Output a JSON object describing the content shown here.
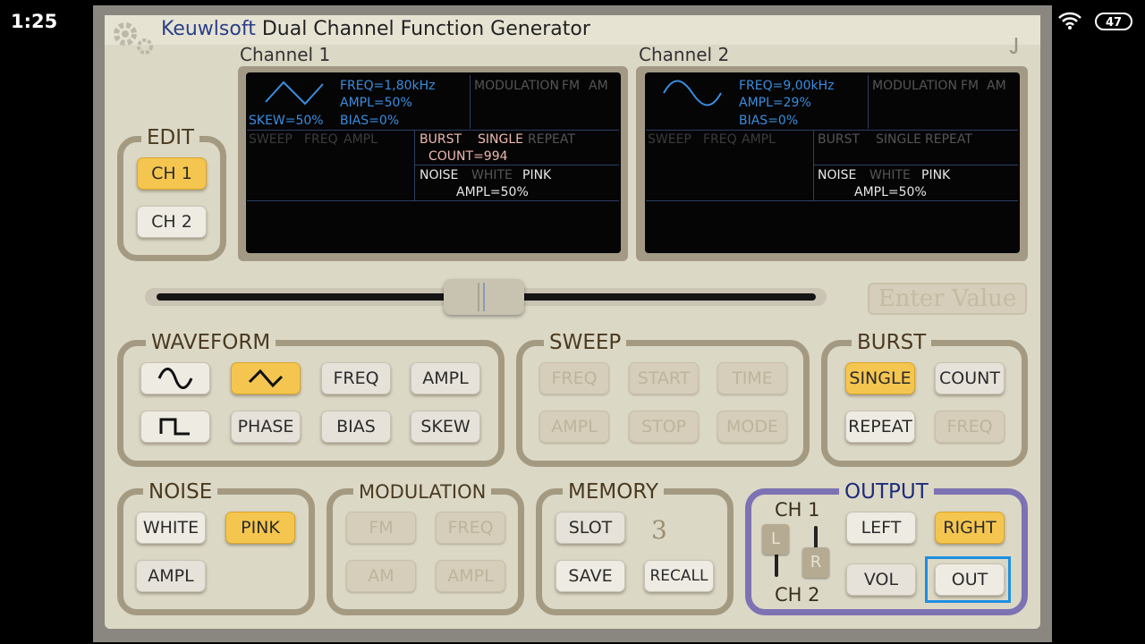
{
  "status": {
    "time": "1:25",
    "dots": "•••",
    "battery": "47"
  },
  "title": {
    "brand": "Keuwlsoft",
    "text": "Dual Channel Function Generator"
  },
  "channels": [
    {
      "label": "Channel 1",
      "freq": "FREQ=1,80kHz",
      "ampl": "AMPL=50%",
      "bias": "BIAS=0%",
      "skew": "SKEW=50%",
      "modulation": "MODULATION",
      "fm": "FM",
      "am": "AM",
      "sweep": "SWEEP",
      "sweep_freq": "FREQ",
      "sweep_ampl": "AMPL",
      "burst": "BURST",
      "burst_single": "SINGLE",
      "burst_repeat": "REPEAT",
      "count": "COUNT=994",
      "noise": "NOISE",
      "noise_white": "WHITE",
      "noise_pink": "PINK",
      "noise_ampl": "AMPL=50%"
    },
    {
      "label": "Channel 2",
      "freq": "FREQ=9,00kHz",
      "ampl": "AMPL=29%",
      "bias": "BIAS=0%",
      "modulation": "MODULATION",
      "fm": "FM",
      "am": "AM",
      "sweep": "SWEEP",
      "sweep_freq": "FREQ",
      "sweep_ampl": "AMPL",
      "burst": "BURST",
      "burst_single": "SINGLE",
      "burst_repeat": "REPEAT",
      "noise": "NOISE",
      "noise_white": "WHITE",
      "noise_pink": "PINK",
      "noise_ampl": "AMPL=50%"
    }
  ],
  "edit": {
    "label": "EDIT",
    "ch1": "CH 1",
    "ch2": "CH 2"
  },
  "enter_value": "Enter Value",
  "waveform": {
    "label": "WAVEFORM",
    "freq": "FREQ",
    "ampl": "AMPL",
    "phase": "PHASE",
    "bias": "BIAS",
    "skew": "SKEW"
  },
  "sweep": {
    "label": "SWEEP",
    "freq": "FREQ",
    "start": "START",
    "time": "TIME",
    "ampl": "AMPL",
    "stop": "STOP",
    "mode": "MODE"
  },
  "burst": {
    "label": "BURST",
    "single": "SINGLE",
    "count": "COUNT",
    "repeat": "REPEAT",
    "freq": "FREQ"
  },
  "noise": {
    "label": "NOISE",
    "white": "WHITE",
    "pink": "PINK",
    "ampl": "AMPL"
  },
  "modulation": {
    "label": "MODULATION",
    "fm": "FM",
    "freq": "FREQ",
    "am": "AM",
    "ampl": "AMPL"
  },
  "memory": {
    "label": "MEMORY",
    "slot": "SLOT",
    "slot_value": "3",
    "save": "SAVE",
    "recall": "RECALL"
  },
  "output": {
    "label": "OUTPUT",
    "ch1": "CH 1",
    "ch2": "CH 2",
    "l": "L",
    "r": "R",
    "left": "LEFT",
    "right": "RIGHT",
    "vol": "VOL",
    "out": "OUT"
  },
  "colors": {
    "accent_yellow": "#f5c64f",
    "screen_blue": "#3a8de0",
    "output_border": "#7d72b3",
    "selection_blue": "#1e8fe0"
  }
}
